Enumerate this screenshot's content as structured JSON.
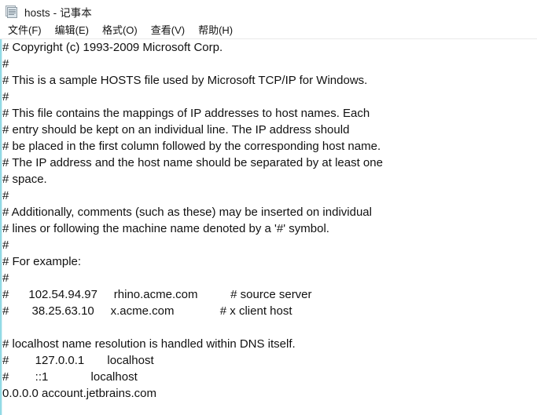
{
  "window": {
    "title": "hosts - 记事本",
    "document_name": "hosts",
    "app_name": "记事本",
    "icon": "notepad-document-icon",
    "background_color": "#ffffff",
    "text_color": "#111111",
    "edge_accent_color": "#7fd3e0"
  },
  "menubar": {
    "items": [
      {
        "label": "文件(F)",
        "name": "file"
      },
      {
        "label": "编辑(E)",
        "name": "edit"
      },
      {
        "label": "格式(O)",
        "name": "format"
      },
      {
        "label": "查看(V)",
        "name": "view"
      },
      {
        "label": "帮助(H)",
        "name": "help"
      }
    ]
  },
  "editor": {
    "lines": [
      "# Copyright (c) 1993-2009 Microsoft Corp.",
      "#",
      "# This is a sample HOSTS file used by Microsoft TCP/IP for Windows.",
      "#",
      "# This file contains the mappings of IP addresses to host names. Each",
      "# entry should be kept on an individual line. The IP address should",
      "# be placed in the first column followed by the corresponding host name.",
      "# The IP address and the host name should be separated by at least one",
      "# space.",
      "#",
      "# Additionally, comments (such as these) may be inserted on individual",
      "# lines or following the machine name denoted by a '#' symbol.",
      "#",
      "# For example:",
      "#",
      "#      102.54.94.97     rhino.acme.com          # source server",
      "#       38.25.63.10     x.acme.com              # x client host",
      "",
      "# localhost name resolution is handled within DNS itself.",
      "#        127.0.0.1       localhost",
      "#        ::1             localhost",
      "0.0.0.0 account.jetbrains.com"
    ]
  }
}
